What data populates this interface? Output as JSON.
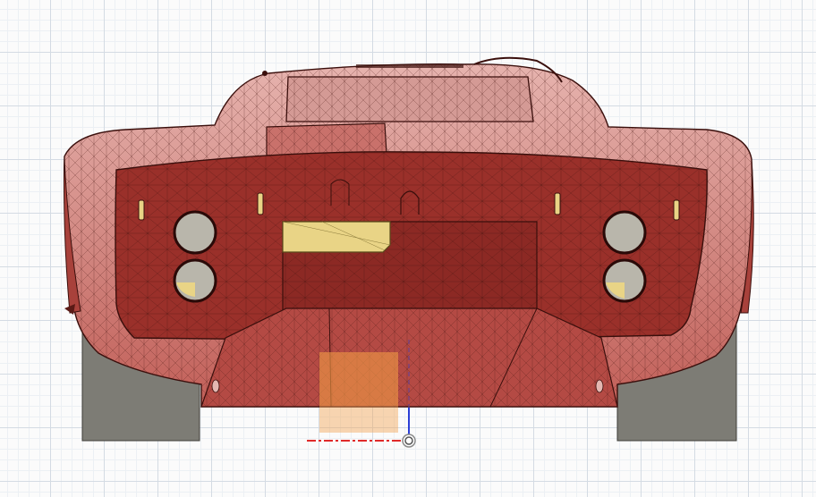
{
  "viewport": {
    "view": "Back",
    "grid": true,
    "visual_style": "Shaded with visible edges",
    "colors": {
      "body_paint": "#b8413b",
      "body_paint_light": "#d9928c",
      "body_dark": "#8f2a24",
      "mesh_edge": "#4a1612",
      "tire": "#7d7c75",
      "hole": "#b9b6ab",
      "highlight_yellow": "#e9d486",
      "selection_orange": "#f2a355",
      "axis_y": "#2b3fd6",
      "axis_x": "#e02a2a",
      "grid_major": "#d4dbe3",
      "grid_minor": "#ecf0f4"
    },
    "icons": [
      "origin-marker-icon"
    ]
  }
}
